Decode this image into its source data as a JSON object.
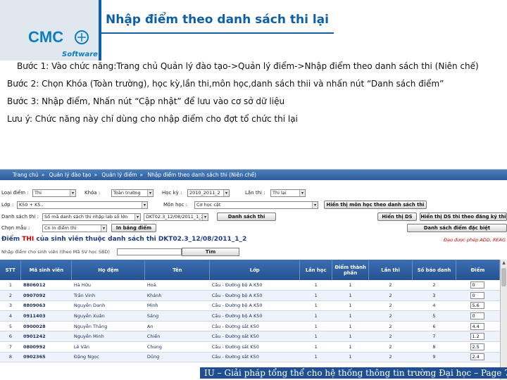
{
  "slide": {
    "title": "Nhập điểm theo danh sách thi lại",
    "logo_text": "CMC",
    "logo_sub": "Software",
    "bullets": [
      "Bước 1: Vào chức năng:Trang chủ Quản lý đào tạo->Quản lý điểm->Nhập điểm theo danh sách thi (Niên chế)",
      "Bước 2: Chọn Khóa (Toàn trường), học kỳ,lần thi,môn học,danh sách thii và nhấn nút “Danh sách điểm”",
      "Bước 3: Nhập điểm, Nhấn nút “Cập nhật” để lưu vào cơ sở dữ liệu",
      "Lưu ý: Chức năng này chỉ dùng cho nhập điểm cho đợt tổ chức thi lại"
    ],
    "footer": "IU – Giải pháp tổng thể cho hệ thống thông tin trường Đại học – Page 7"
  },
  "app": {
    "breadcrumb": [
      "Trang chủ",
      "Quản lý đào tạo",
      "Quản lý điểm",
      "Nhập điểm theo danh sách thi (Niên chế)"
    ],
    "filters": {
      "loai_diem_label": "Loại điểm :",
      "loai_diem_value": "Thi",
      "khoa_label": "Khóa :",
      "khoa_value": "Toàn trường",
      "hoc_ky_label": "Học kỳ :",
      "hoc_ky_value": "2010_2011_2",
      "lan_thi_label": "Lần thi :",
      "lan_thi_value": "Thi lại",
      "lop_label": "Lớp :",
      "lop_value": "K50 + K5..",
      "mon_hoc_label": "Môn học :",
      "mon_hoc_value": "Cơ học cặt",
      "danh_sach_thi_label": "Danh sách thi :",
      "danh_sach_thi_value": "Số mã danh sách thi nhập lab số lớn",
      "danh_sach_thi_code": "DKT02.3_12/08/2011_1_2",
      "chon_mau_label": "Chọn mẫu :",
      "chon_mau_value": "Cn in điểm thi"
    },
    "buttons": {
      "hien_thi_mon": "Hiển thị môn học theo danh sách thi",
      "danh_sach_thi": "Danh sách thi",
      "hien_thi_ds": "Hiển thị DS",
      "hien_thi_ds_dang_ky": "Hiển thị DS thi theo đăng ký thi",
      "in_bang_diem": "In bảng điểm",
      "danh_sach_diem_dac_biet": "Danh sách điểm đặc biệt",
      "tim": "Tìm"
    },
    "section_title_prefix": "Điểm",
    "section_title_thi": "THI",
    "section_title_rest": "của sinh viên thuộc danh sách thi DKT02.3_12/08/2011_1_2",
    "note_red": "Đạo được phép ADD, REAG",
    "search_hint": "Nhập điểm cho sinh viên (theo Mã SV học SBD)",
    "table": {
      "headers": [
        "STT",
        "Mã sinh viên",
        "Họ đệm",
        "Tên",
        "Lớp",
        "Lần học",
        "Điểm thành phần",
        "Lần thi",
        "Số báo danh",
        "Điểm"
      ],
      "rows": [
        [
          "1",
          "8806012",
          "Hà Hữu",
          "Hoà",
          "Cầu - Đường bộ A K50",
          "1",
          "1",
          "2",
          "2",
          "0"
        ],
        [
          "2",
          "0907092",
          "Trần Vinh",
          "Khánh",
          "Cầu - Đường bộ A K50",
          "1",
          "1",
          "2",
          "3",
          "0"
        ],
        [
          "3",
          "8809063",
          "Nguyễn Danh",
          "Minh",
          "Cầu - Đường bộ A K50",
          "1",
          "1",
          "2",
          "4",
          "5.6"
        ],
        [
          "4",
          "0911403",
          "Nguyễn Xuân",
          "Sáng",
          "Cầu - Đường bộ A K50",
          "1",
          "1",
          "2",
          "5",
          "0"
        ],
        [
          "5",
          "0900028",
          "Nguyễn Thắng",
          "An",
          "Cầu - Đường sắt K50",
          "1",
          "1",
          "2",
          "6",
          "4.4"
        ],
        [
          "6",
          "0901242",
          "Nguyễn Minh",
          "Chiến",
          "Cầu - Đường sắt K50",
          "1",
          "1",
          "2",
          "7",
          "1.2"
        ],
        [
          "7",
          "0800992",
          "Lê Văn",
          "Chung",
          "Cầu - Đường sắt K50",
          "1",
          "1",
          "2",
          "8",
          "2.5"
        ],
        [
          "8",
          "0902365",
          "Đặng Ngọc",
          "Dũng",
          "Cầu - Đường sắt K50",
          "1",
          "1",
          "2",
          "9",
          "2.4"
        ]
      ]
    }
  },
  "colors": {
    "title_blue": "#0f5fa6",
    "header_blue": "#2d5d9b",
    "note_red": "#c80000"
  }
}
